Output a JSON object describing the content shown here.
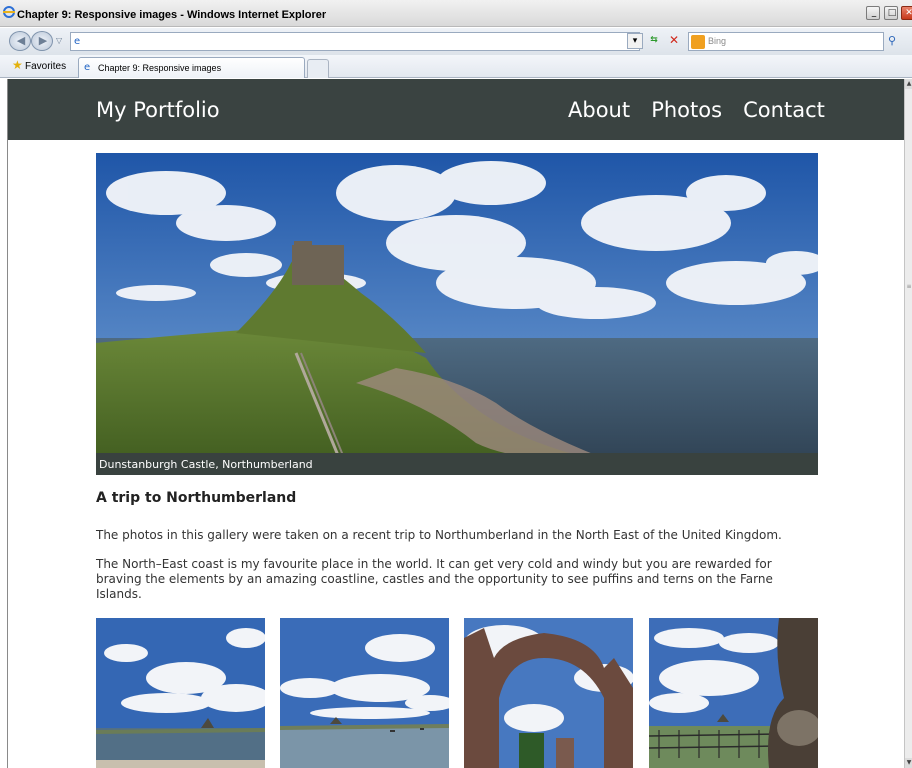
{
  "window": {
    "title": "Chapter 9: Responsive images - Windows Internet Explorer",
    "min_glyph": "_",
    "max_glyph": "□",
    "close_glyph": "✕"
  },
  "toolbar": {
    "address_value": "",
    "search_placeholder": "Bing",
    "favorites_label": "Favorites",
    "tab_label": "Chapter 9: Responsive images"
  },
  "site": {
    "title": "My Portfolio",
    "nav": [
      "About",
      "Photos",
      "Contact"
    ]
  },
  "hero": {
    "caption": "Dunstanburgh Castle, Northumberland"
  },
  "article": {
    "heading": "A trip to Northumberland",
    "paragraphs": [
      "The photos in this gallery were taken on a recent trip to Northumberland in the North East of the United Kingdom.",
      "The North–East coast is my favourite place in the world. It can get very cold and windy but you are rewarded for braving the elements by an amazing coastline, castles and the opportunity to see puffins and terns on the Farne Islands."
    ]
  },
  "colors": {
    "header_bg": "#3a4341",
    "caption_bg": "#39423f",
    "sky": "#2a5fb2"
  },
  "gallery": {
    "thumbnails": [
      "coast-castle-small",
      "harbour-boats",
      "ruined-arch",
      "castle-railings"
    ]
  }
}
